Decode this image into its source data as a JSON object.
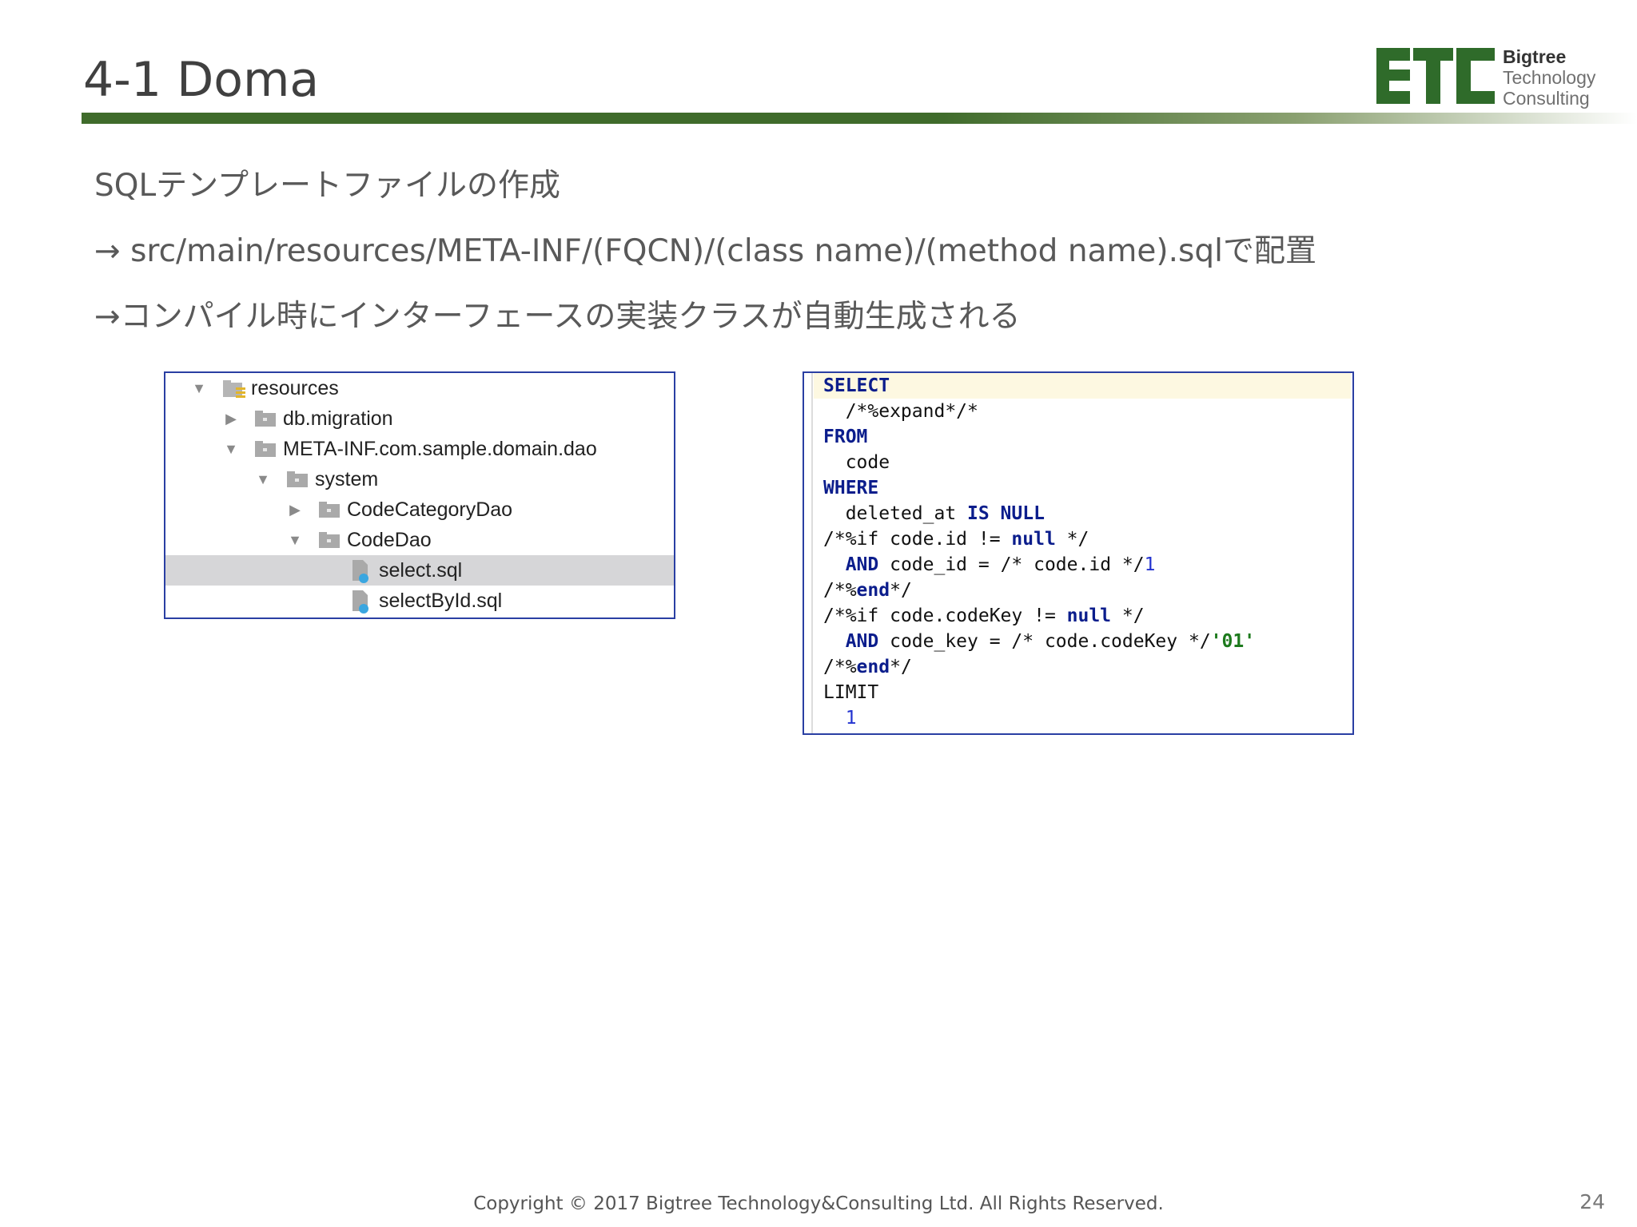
{
  "slide": {
    "title": "4-1 Doma",
    "page_number": "24",
    "footer": "Copyright © 2017 Bigtree Technology&Consulting Ltd. All Rights Reserved.",
    "accent_color": "#3f6b2b"
  },
  "logo": {
    "mark": "BTC",
    "line1": "Bigtree",
    "line2": "Technology",
    "line3": "Consulting"
  },
  "body": {
    "line1": "SQLテンプレートファイルの作成",
    "line2": "→ src/main/resources/META-INF/(FQCN)/(class name)/(method name).sqlで配置",
    "line3": "→コンパイル時にインターフェースの実装クラスが自動生成される"
  },
  "tree": {
    "rows": [
      {
        "label": "resources",
        "icon": "resources-folder-icon",
        "arrow": "▼"
      },
      {
        "label": "db.migration",
        "icon": "folder-icon",
        "arrow": "▶"
      },
      {
        "label": "META-INF.com.sample.domain.dao",
        "icon": "folder-icon",
        "arrow": "▼"
      },
      {
        "label": "system",
        "icon": "folder-icon",
        "arrow": "▼"
      },
      {
        "label": "CodeCategoryDao",
        "icon": "folder-icon",
        "arrow": "▶"
      },
      {
        "label": "CodeDao",
        "icon": "folder-icon",
        "arrow": "▼"
      },
      {
        "label": "select.sql",
        "icon": "sql-file-icon",
        "selected": true
      },
      {
        "label": "selectById.sql",
        "icon": "sql-file-icon"
      }
    ]
  },
  "code": {
    "l1_kw": "SELECT",
    "l2_text": "  /*%expand*/*",
    "l3_kw": "FROM",
    "l4_text": "  code",
    "l5_kw": "WHERE",
    "l6_pre": "  deleted_at ",
    "l6_kw": "IS NULL",
    "l7_pre": "/*%if code.id != ",
    "l7_kw": "null",
    "l7_post": " */",
    "l8_kw": "  AND",
    "l8_mid": " code_id = /* code.id */",
    "l8_num": "1",
    "l9_pre": "/*%",
    "l9_kw": "end",
    "l9_post": "*/",
    "l10_pre": "/*%if code.codeKey != ",
    "l10_kw": "null",
    "l10_post": " */",
    "l11_kw": "  AND",
    "l11_mid": " code_key = /* code.codeKey */",
    "l11_str": "'01'",
    "l12_pre": "/*%",
    "l12_kw": "end",
    "l12_post": "*/",
    "l13_text": "LIMIT",
    "l14_pre": "  ",
    "l14_num": "1"
  }
}
